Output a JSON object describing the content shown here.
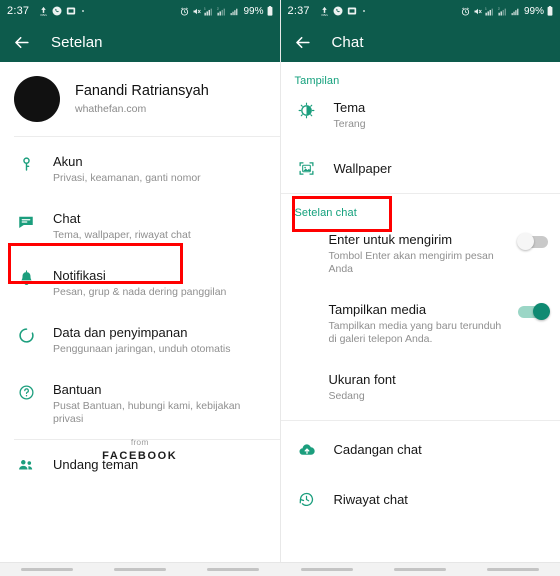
{
  "status_bar": {
    "time": "2:37",
    "battery": "99%",
    "left_icons": [
      "data-usage-icon",
      "whatsapp-icon",
      "screenshot-icon",
      "dot-icon"
    ],
    "right_icons": [
      "alarm-icon",
      "mute-icon",
      "sim1-signal-icon",
      "sim2-signal-icon",
      "wifi-signal-icon",
      "battery-icon"
    ]
  },
  "theme": {
    "header_bg": "#0d5b4c",
    "accent_green": "#13a07c",
    "icon_green": "#1b9e7d",
    "toggle_on": "#0f8a72",
    "highlight_red": "#ff0000"
  },
  "left_screen": {
    "title": "Setelan",
    "back_icon": "back-arrow-icon",
    "profile": {
      "name": "Fanandi Ratriansyah",
      "status": "whathefan.com",
      "avatar": "avatar"
    },
    "items": [
      {
        "icon": "key-icon",
        "title": "Akun",
        "subtitle": "Privasi, keamanan, ganti nomor",
        "highlighted": false
      },
      {
        "icon": "chat-icon",
        "title": "Chat",
        "subtitle": "Tema, wallpaper, riwayat chat",
        "highlighted": true
      },
      {
        "icon": "bell-icon",
        "title": "Notifikasi",
        "subtitle": "Pesan, grup & nada dering panggilan",
        "highlighted": false
      },
      {
        "icon": "data-usage-icon",
        "title": "Data dan penyimpanan",
        "subtitle": "Penggunaan jaringan, unduh otomatis",
        "highlighted": false
      },
      {
        "icon": "help-icon",
        "title": "Bantuan",
        "subtitle": "Pusat Bantuan, hubungi kami, kebijakan privasi",
        "highlighted": false
      }
    ],
    "invite": {
      "icon": "people-icon",
      "title": "Undang teman"
    },
    "footer": {
      "from": "from",
      "brand": "FACEBOOK"
    }
  },
  "right_screen": {
    "title": "Chat",
    "back_icon": "back-arrow-icon",
    "sections": [
      {
        "header": "Tampilan",
        "items": [
          {
            "icon": "theme-contrast-icon",
            "title": "Tema",
            "subtitle": "Terang",
            "highlighted": false
          },
          {
            "icon": "wallpaper-icon",
            "title": "Wallpaper",
            "subtitle": "",
            "highlighted": true
          }
        ]
      },
      {
        "header": "Setelan chat",
        "items": [
          {
            "icon": "",
            "title": "Enter untuk mengirim",
            "subtitle": "Tombol Enter akan mengirim pesan Anda",
            "toggle": "off",
            "highlighted": false
          },
          {
            "icon": "",
            "title": "Tampilkan media",
            "subtitle": "Tampilkan media yang baru terunduh di galeri telepon Anda.",
            "toggle": "on",
            "highlighted": false
          },
          {
            "icon": "",
            "title": "Ukuran font",
            "subtitle": "Sedang",
            "toggle": "",
            "highlighted": false
          }
        ]
      }
    ],
    "bottom_items": [
      {
        "icon": "cloud-upload-icon",
        "title": "Cadangan chat"
      },
      {
        "icon": "history-clock-icon",
        "title": "Riwayat chat"
      }
    ]
  },
  "nav_bar": {
    "pills": 6
  }
}
